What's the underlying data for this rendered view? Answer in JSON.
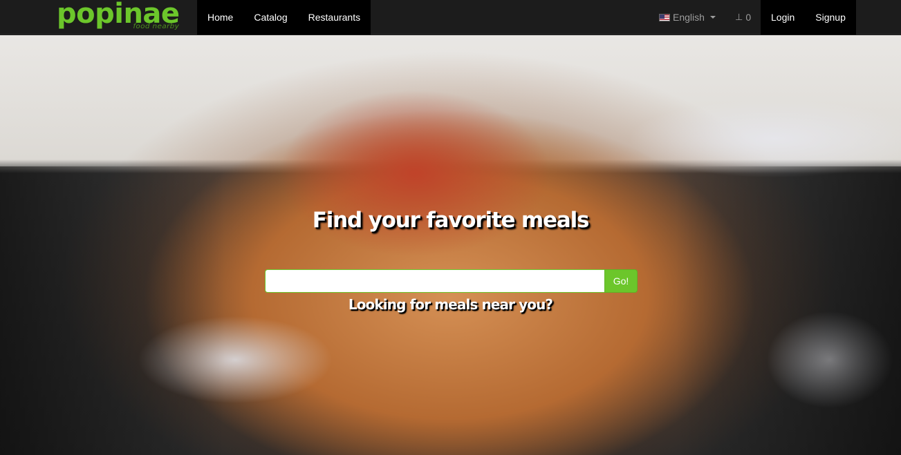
{
  "brand": {
    "name": "popinae",
    "tagline": "food nearby",
    "color": "#6cc62b"
  },
  "nav": {
    "left": [
      {
        "label": "Home"
      },
      {
        "label": "Catalog"
      },
      {
        "label": "Restaurants"
      }
    ],
    "language": {
      "label": "English",
      "icon": "us-flag-icon"
    },
    "cart": {
      "icon": "cart-icon",
      "count": "0"
    },
    "right": [
      {
        "label": "Login"
      },
      {
        "label": "Signup"
      }
    ]
  },
  "hero": {
    "title": "Find your favorite meals",
    "search": {
      "value": "",
      "placeholder": "",
      "button_label": "Go!"
    },
    "subtitle": "Looking for meals near you?"
  }
}
